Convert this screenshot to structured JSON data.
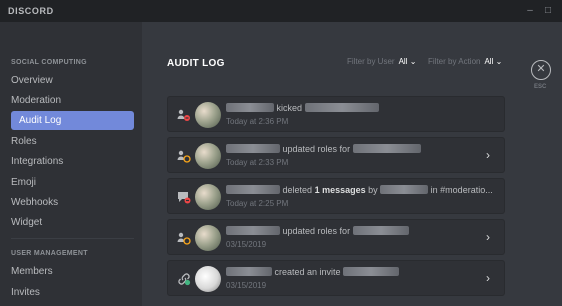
{
  "window": {
    "brand": "DISCORD",
    "minimize_glyph": "–",
    "maximize_glyph": "□"
  },
  "sidebar": {
    "server_heading": "SOCIAL COMPUTING",
    "server_items": [
      {
        "label": "Overview"
      },
      {
        "label": "Moderation"
      },
      {
        "label": "Audit Log",
        "active": true
      },
      {
        "label": "Roles"
      },
      {
        "label": "Integrations"
      },
      {
        "label": "Emoji"
      },
      {
        "label": "Webhooks"
      },
      {
        "label": "Widget"
      }
    ],
    "user_heading": "USER MANAGEMENT",
    "user_items": [
      {
        "label": "Members"
      },
      {
        "label": "Invites"
      }
    ]
  },
  "main": {
    "title": "AUDIT LOG",
    "filter_user_label": "Filter by User",
    "filter_user_value": "All",
    "filter_action_label": "Filter by Action",
    "filter_action_value": "All",
    "close_glyph": "✕",
    "close_label": "ESC",
    "entries": [
      {
        "icon": "member-kick-icon",
        "action": "kicked",
        "time": "Today at 2:36 PM",
        "expandable": false
      },
      {
        "icon": "role-update-icon",
        "action": "updated roles for",
        "time": "Today at 2:33 PM",
        "expandable": true
      },
      {
        "icon": "message-delete-icon",
        "action_pre": "deleted",
        "action_bold": "1 messages",
        "action_mid": "by",
        "action_post": "in #moderatio...",
        "time": "Today at 2:25 PM",
        "expandable": false
      },
      {
        "icon": "role-update-icon",
        "action": "updated roles for",
        "time": "03/15/2019",
        "expandable": true
      },
      {
        "icon": "invite-create-icon",
        "action": "created an invite",
        "time": "03/15/2019",
        "expandable": true
      }
    ],
    "chevron_glyph": "›",
    "dropdown_glyph": "⌄"
  },
  "colors": {
    "background": "#36393f",
    "sidebar": "#2f3136",
    "titlebar": "#202225",
    "accent": "#7289da",
    "danger": "#f04747",
    "warning": "#faa61a",
    "success": "#43b581"
  }
}
